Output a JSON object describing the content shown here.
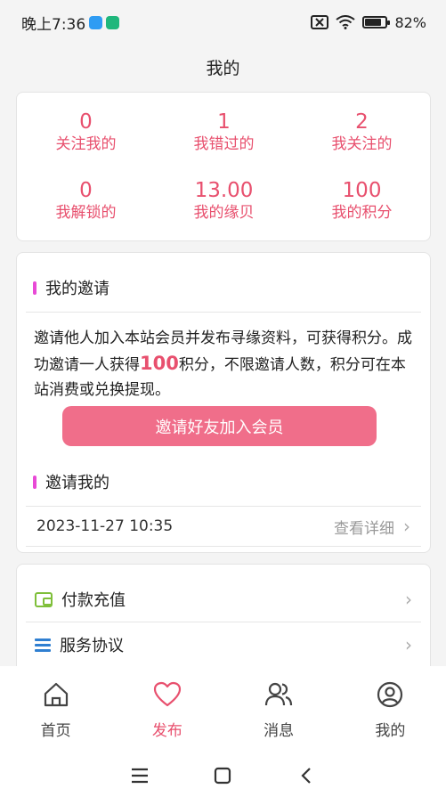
{
  "status_bar": {
    "time": "晚上7:36",
    "battery": "82%"
  },
  "header": {
    "title": "我的"
  },
  "stats": [
    {
      "value": "0",
      "label": "关注我的"
    },
    {
      "value": "1",
      "label": "我错过的"
    },
    {
      "value": "2",
      "label": "我关注的"
    },
    {
      "value": "0",
      "label": "我解锁的"
    },
    {
      "value": "13.00",
      "label": "我的缘贝"
    },
    {
      "value": "100",
      "label": "我的积分"
    }
  ],
  "invite": {
    "title": "我的邀请",
    "text_before": "邀请他人加入本站会员并发布寻缘资料，可获得积分。成功邀请一人获得",
    "highlight": "100",
    "text_after": "积分，不限邀请人数，积分可在本站消费或兑换提现。",
    "button_label": "邀请好友加入会员",
    "invited_title": "邀请我的",
    "invited_date": "2023-11-27 10:35",
    "invited_detail": "查看详细"
  },
  "menu": [
    {
      "label": "付款充值",
      "icon": "wallet-icon"
    },
    {
      "label": "服务协议",
      "icon": "list-icon"
    }
  ],
  "bottom_nav": [
    {
      "label": "首页",
      "icon": "home-icon"
    },
    {
      "label": "发布",
      "icon": "heart-icon"
    },
    {
      "label": "消息",
      "icon": "users-icon"
    },
    {
      "label": "我的",
      "icon": "profile-icon"
    }
  ],
  "colors": {
    "accent": "#e8506e",
    "button": "#f06e8a",
    "section_bar": "#e84ad6"
  }
}
